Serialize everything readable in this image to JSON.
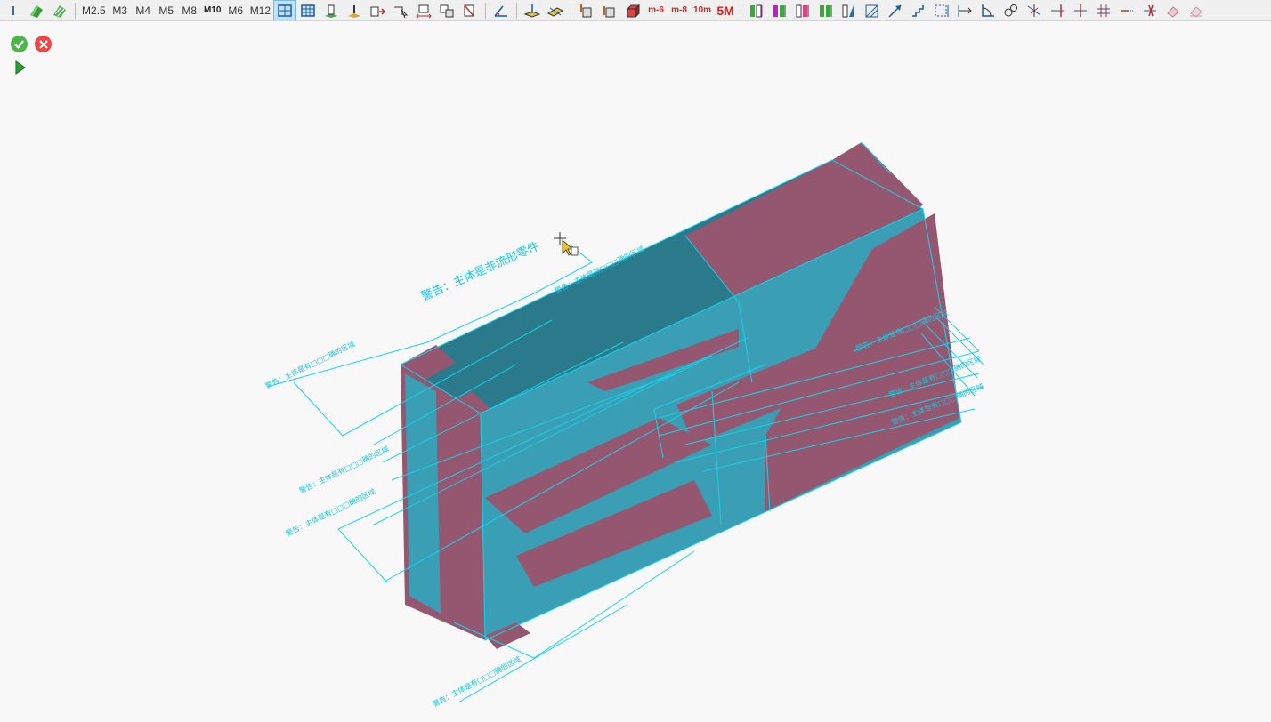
{
  "toolbar": {
    "materials": [
      "M2.5",
      "M3",
      "M4",
      "M5",
      "M8",
      "M10",
      "M6",
      "M12"
    ],
    "labels_red": [
      "m-6",
      "m-8",
      "10m"
    ],
    "label_5m": "5M",
    "colors": {
      "accent_red": "#d42020",
      "highlight": "#bfe3ff"
    }
  },
  "actions": {
    "accept_icon": "check-icon",
    "cancel_icon": "close-icon",
    "run_icon": "play-icon"
  },
  "model": {
    "warning_main": "警告：主体是非流形零件",
    "warning_items": [
      "警告：主体是有□□□确的区域",
      "警告：主体是有□□□确的区域",
      "警告：主体是有□□□确的区域",
      "警告：主体是有□□□确的区域",
      "警告：主体是有□□□确的区域",
      "警告：主体是有□□□确的区域",
      "警告：主体是有□□□确的区域",
      "警告：主体是有□□□确的区域"
    ],
    "colors": {
      "face_teal": "#3a9eb5",
      "face_dark": "#2a7a8c",
      "face_mauve": "#955670",
      "edge": "#16d4ec"
    }
  }
}
